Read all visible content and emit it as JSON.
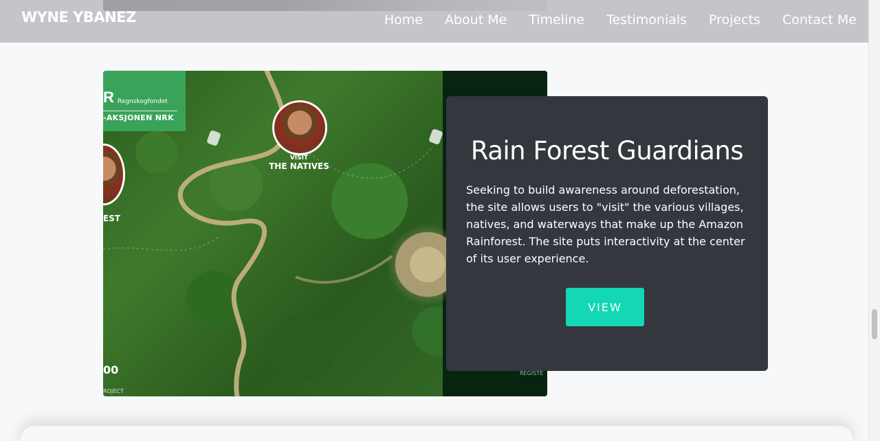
{
  "navbar": {
    "brand": "WYNE YBANEZ",
    "links": [
      {
        "label": "Home"
      },
      {
        "label": "About Me"
      },
      {
        "label": "Timeline"
      },
      {
        "label": "Testimonials"
      },
      {
        "label": "Projects"
      },
      {
        "label": "Contact Me"
      }
    ]
  },
  "project": {
    "title": "Rain Forest Guardians",
    "description": "Seeking to build awareness around deforestation, the site allows users to \"visit\" the various villages, natives, and waterways that make up the Amazon Rainforest. The site puts interactivity at the center of its user experience.",
    "button_label": "VIEW",
    "image": {
      "logo_org": "Regnskogfondet",
      "logo_campaign": "-AKSJONEN NRK",
      "map_label_visit": "VISIT",
      "map_label_natives": "THE NATIVES",
      "map_label_left": "EST",
      "corner_text": "00",
      "corner_subtext": "ROJECT",
      "right_text": "REGISTE"
    }
  },
  "colors": {
    "accent": "#14d7b6",
    "card_bg": "#34373e",
    "page_bg": "#f7f8fa",
    "navbar_bg": "#b8babe"
  }
}
